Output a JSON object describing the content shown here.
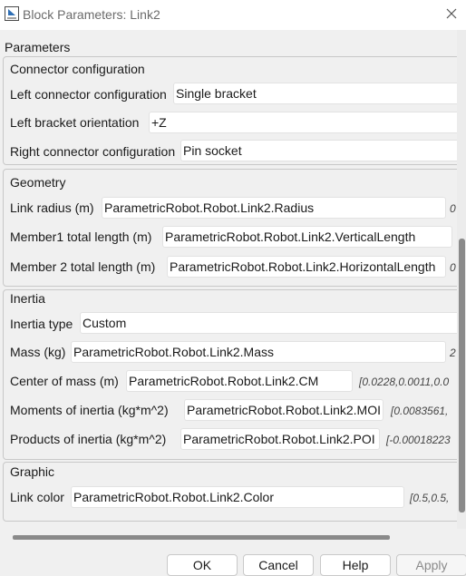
{
  "window": {
    "title": "Block Parameters: Link2",
    "icon": "block-parameters-icon",
    "close_icon": "close-icon"
  },
  "parameters_label": "Parameters",
  "connector": {
    "title": "Connector configuration",
    "left_config_label": "Left connector configuration",
    "left_config_value": "Single bracket",
    "left_orient_label": "Left bracket orientation",
    "left_orient_value": "+Z",
    "right_config_label": "Right connector configuration",
    "right_config_value": "Pin socket"
  },
  "geometry": {
    "title": "Geometry",
    "radius_label": "Link radius (m)",
    "radius_value": "ParametricRobot.Robot.Link2.Radius",
    "radius_eval": "0",
    "member1_label": "Member1 total length (m)",
    "member1_value": "ParametricRobot.Robot.Link2.VerticalLength",
    "member2_label": "Member 2 total length (m)",
    "member2_value": "ParametricRobot.Robot.Link2.HorizontalLength",
    "member2_eval": "0"
  },
  "inertia": {
    "title": "Inertia",
    "type_label": "Inertia type",
    "type_value": "Custom",
    "mass_label": "Mass (kg)",
    "mass_value": "ParametricRobot.Robot.Link2.Mass",
    "mass_eval": "2",
    "com_label": "Center of mass (m)",
    "com_value": "ParametricRobot.Robot.Link2.CM",
    "com_eval": "[0.0228,0.0011,0.0",
    "moi_label": "Moments of inertia (kg*m^2)",
    "moi_value": "ParametricRobot.Robot.Link2.MOI",
    "moi_eval": "[0.0083561,",
    "poi_label": "Products of inertia (kg*m^2)",
    "poi_value": "ParametricRobot.Robot.Link2.POI",
    "poi_eval": "[-0.00018223"
  },
  "graphic": {
    "title": "Graphic",
    "color_label": "Link color",
    "color_value": "ParametricRobot.Robot.Link2.Color",
    "color_eval": "[0.5,0.5,"
  },
  "buttons": {
    "ok": "OK",
    "cancel": "Cancel",
    "help": "Help",
    "apply": "Apply"
  }
}
